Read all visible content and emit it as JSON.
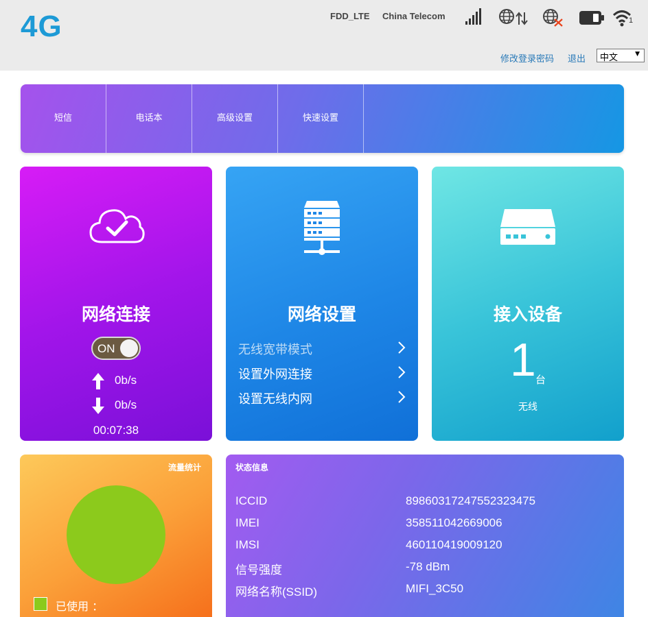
{
  "header": {
    "logo": "4G",
    "network_type": "FDD_LTE",
    "carrier": "China Telecom",
    "wifi_clients": "1",
    "change_password": "修改登录密码",
    "logout": "退出",
    "language": "中文",
    "icons": [
      "signal-strength-icon",
      "internet-connected-icon",
      "roaming-disabled-icon",
      "battery-icon",
      "wifi-icon"
    ]
  },
  "nav": {
    "items": [
      {
        "label": "短信"
      },
      {
        "label": "电话本"
      },
      {
        "label": "高级设置"
      },
      {
        "label": "快速设置"
      }
    ]
  },
  "network": {
    "title": "网络连接",
    "toggle_label": "ON",
    "upload_speed": "0b/s",
    "download_speed": "0b/s",
    "duration": "00:07:38",
    "icon": "cloud-check-icon"
  },
  "settings": {
    "title": "网络设置",
    "icon": "server-icon",
    "items": [
      {
        "label": "无线宽带模式"
      },
      {
        "label": "设置外网连接"
      },
      {
        "label": "设置无线内网"
      }
    ]
  },
  "devices": {
    "title": "接入设备",
    "icon": "router-icon",
    "count": "1",
    "unit": "台",
    "type": "无线"
  },
  "traffic": {
    "title": "流量统计",
    "legend_used": "已使用 ：",
    "used_color": "#8cca1c"
  },
  "status": {
    "title": "状态信息",
    "rows": [
      {
        "key": "ICCID",
        "value": "89860317247552323475"
      },
      {
        "key": "IMEI",
        "value": "358511042669006"
      },
      {
        "key": "IMSI",
        "value": "460110419009120"
      },
      {
        "key": "信号强度",
        "value": "-78 dBm"
      },
      {
        "key": "网络名称(SSID)",
        "value": "MIFI_3C50"
      }
    ]
  }
}
